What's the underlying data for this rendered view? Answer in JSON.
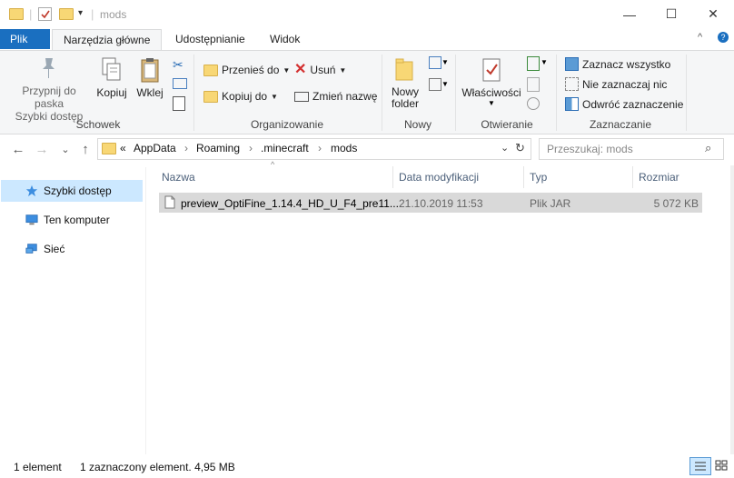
{
  "window": {
    "title": "mods",
    "separator": "|",
    "minimize": "—",
    "maximize": "☐",
    "close": "✕"
  },
  "ribbon": {
    "tabs": [
      "Plik",
      "Narzędzia główne",
      "Udostępnianie",
      "Widok"
    ],
    "clipboard": {
      "pin_line1": "Przypnij do paska",
      "pin_line2": "Szybki dostęp",
      "copy": "Kopiuj",
      "paste": "Wklej",
      "group": "Schowek"
    },
    "organize": {
      "move_to": "Przenieś do",
      "copy_to": "Kopiuj do",
      "delete": "Usuń",
      "rename": "Zmień nazwę",
      "group": "Organizowanie"
    },
    "new": {
      "new_folder_line1": "Nowy",
      "new_folder_line2": "folder",
      "group": "Nowy"
    },
    "open": {
      "properties": "Właściwości",
      "group": "Otwieranie"
    },
    "select": {
      "select_all": "Zaznacz wszystko",
      "select_none": "Nie zaznaczaj nic",
      "invert": "Odwróć zaznaczenie",
      "group": "Zaznaczanie"
    }
  },
  "navigation": {
    "back": "←",
    "forward": "→",
    "recent": "⌄",
    "up": "↑",
    "overflow": "«",
    "breadcrumb": [
      "AppData",
      "Roaming",
      ".minecraft",
      "mods"
    ],
    "crumb_sep": "›",
    "search_placeholder": "Przeszukaj: mods"
  },
  "sidebar": {
    "items": [
      {
        "label": "Szybki dostęp",
        "icon": "star-icon",
        "selected": true
      },
      {
        "label": "Ten komputer",
        "icon": "computer-icon",
        "selected": false
      },
      {
        "label": "Sieć",
        "icon": "network-icon",
        "selected": false
      }
    ]
  },
  "list": {
    "columns": [
      "Nazwa",
      "Data modyfikacji",
      "Typ",
      "Rozmiar"
    ],
    "rows": [
      {
        "name": "preview_OptiFine_1.14.4_HD_U_F4_pre11....",
        "modified": "21.10.2019 11:53",
        "type": "Plik JAR",
        "size": "5 072 KB",
        "selected": true
      }
    ]
  },
  "status": {
    "count": "1 element",
    "selection": "1 zaznaczony element. 4,95 MB"
  },
  "colors": {
    "accent": "#1a6fc0",
    "selected_row": "#d9d9d9",
    "sidebar_selected": "#cce8ff",
    "folder": "#f8d775"
  }
}
